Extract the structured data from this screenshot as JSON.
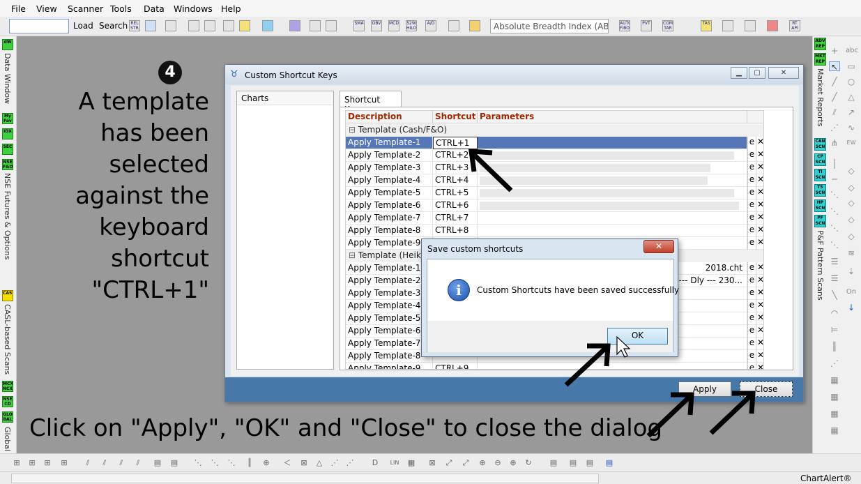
{
  "menubar": {
    "items": [
      "File",
      "View",
      "Scanner",
      "Tools",
      "Data",
      "Windows",
      "Help"
    ]
  },
  "toolbar": {
    "load_label": "Load",
    "search_label": "Search",
    "search_input_value": "",
    "rel_str_label": "REL STR",
    "breadth_select_value": "Absolute Breadth Index (ABI",
    "icon_labels": [
      "SMA",
      "OBV",
      "MCD",
      "52W HILO",
      "A/D",
      "AUTO FIBO",
      "PVT",
      "COM TAR",
      "TAS",
      "RT API"
    ]
  },
  "left_strip": {
    "icons": [
      "dW",
      "My Fav",
      "IDX",
      "SEC",
      "NSE F&O",
      "CASL",
      "MCX NCX",
      "NSE CD",
      "GLO BAL"
    ],
    "labels": [
      "Data Window",
      "NSE Futures & Options",
      "CASL-based Scans",
      "Global E"
    ]
  },
  "right_strip": {
    "icons": [
      "ADV REP",
      "MKT REP",
      "CAN SCN",
      "CP SCN",
      "TI SCN",
      "TS SCN",
      "HP SCN",
      "PF SCN"
    ],
    "labels": [
      "Market Reports",
      "P&F Pattern Scans"
    ]
  },
  "draw_strip": {
    "labels": [
      "abc",
      "EW",
      "On"
    ]
  },
  "annotation": {
    "step_badge": "4",
    "left_note": "A template has been selected against the keyboard shortcut \"CTRL+1\"",
    "bottom_note": "Click on \"Apply\", \"OK\" and \"Close\" to close the dialog"
  },
  "dialog": {
    "title": "Custom Shortcut Keys",
    "charts_label": "Charts",
    "tab_label": "Shortcut Keys",
    "columns": [
      "Description",
      "Shortcut",
      "Parameters"
    ],
    "groups": [
      {
        "name": "Template (Cash/F&O)",
        "rows": [
          {
            "description": "Apply Template-1",
            "shortcut": "CTRL+1",
            "params": "",
            "fill": 0,
            "selected": true
          },
          {
            "description": "Apply Template-2",
            "shortcut": "CTRL+2",
            "params": "",
            "fill": 0.97
          },
          {
            "description": "Apply Template-3",
            "shortcut": "CTRL+3",
            "params": "",
            "fill": 0.88
          },
          {
            "description": "Apply Template-4",
            "shortcut": "CTRL+4",
            "params": "",
            "fill": 0.87
          },
          {
            "description": "Apply Template-5",
            "shortcut": "CTRL+5",
            "params": "",
            "fill": 0.97
          },
          {
            "description": "Apply Template-6",
            "shortcut": "CTRL+6",
            "params": "",
            "fill": 0.99
          },
          {
            "description": "Apply Template-7",
            "shortcut": "CTRL+7",
            "params": "",
            "fill": 0
          },
          {
            "description": "Apply Template-8",
            "shortcut": "CTRL+8",
            "params": "",
            "fill": 0
          },
          {
            "description": "Apply Template-9",
            "shortcut": "",
            "params": "",
            "fill": 0
          }
        ]
      },
      {
        "name": "Template (Heikin",
        "rows": [
          {
            "description": "Apply Template-1",
            "shortcut": "",
            "params": "2018.cht",
            "fill": 0
          },
          {
            "description": "Apply Template-2",
            "shortcut": "",
            "params": "--- Dly --- 230...",
            "fill": 0
          },
          {
            "description": "Apply Template-3",
            "shortcut": "",
            "params": "",
            "fill": 0
          },
          {
            "description": "Apply Template-4",
            "shortcut": "",
            "params": "",
            "fill": 0
          },
          {
            "description": "Apply Template-5",
            "shortcut": "",
            "params": "",
            "fill": 0
          },
          {
            "description": "Apply Template-6",
            "shortcut": "",
            "params": "",
            "fill": 0
          },
          {
            "description": "Apply Template-7",
            "shortcut": "",
            "params": "",
            "fill": 0
          },
          {
            "description": "Apply Template-8",
            "shortcut": "",
            "params": "",
            "fill": 0
          },
          {
            "description": "Apply Template-9",
            "shortcut": "CTRL+9",
            "params": "",
            "fill": 0
          }
        ]
      }
    ],
    "edit_glyph": "e",
    "delete_glyph": "✕",
    "apply_label": "Apply",
    "close_label": "Close"
  },
  "msgbox": {
    "title": "Save custom shortcuts",
    "message": "Custom Shortcuts have been saved successfully",
    "ok_label": "OK",
    "close_glyph": "✕"
  },
  "status_bar": {
    "app_name": "ChartAlert®"
  }
}
